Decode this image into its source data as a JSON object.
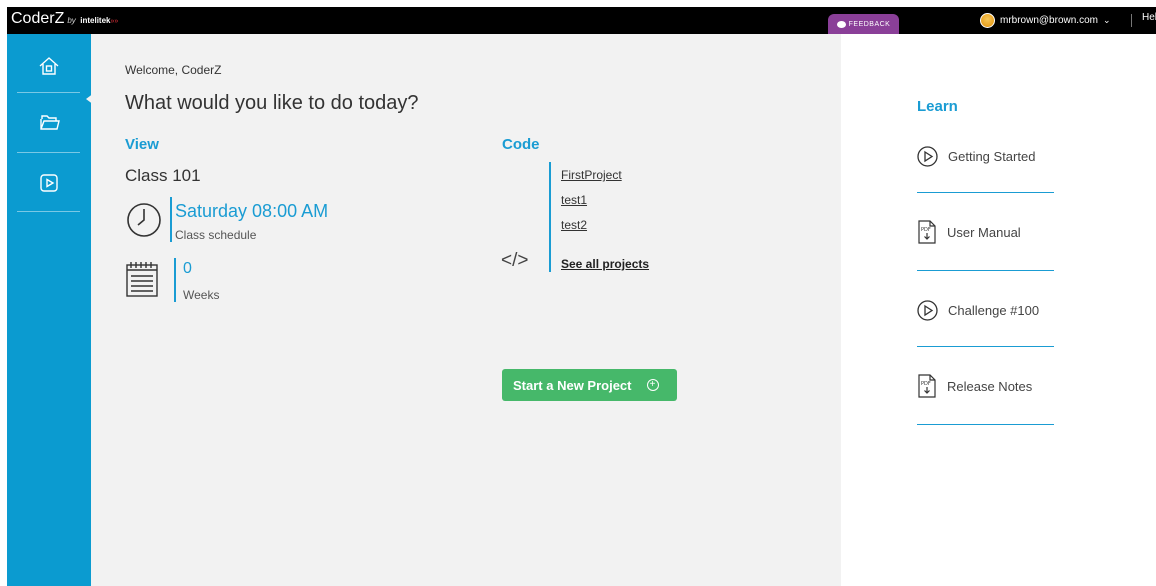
{
  "topbar": {
    "brand": "CoderZ",
    "brand_by": "by",
    "brand_company": "intelitek",
    "brand_arrows": "»»",
    "feedback_label": "FEEDBACK",
    "user_email": "mrbrown@brown.com",
    "help_label": "Help"
  },
  "sidebar": {
    "items": [
      {
        "icon": "home-icon"
      },
      {
        "icon": "folder-icon"
      },
      {
        "icon": "play-icon"
      }
    ]
  },
  "main": {
    "welcome": "Welcome, CoderZ",
    "headline": "What would you like to do today?",
    "view": {
      "heading": "View",
      "class_name": "Class 101",
      "schedule_time": "Saturday 08:00 AM",
      "schedule_label": "Class schedule",
      "weeks_value": "0",
      "weeks_label": "Weeks"
    },
    "code": {
      "heading": "Code",
      "icon_text": "</>",
      "projects": [
        "FirstProject",
        "test1",
        "test2"
      ],
      "see_all": "See all projects"
    },
    "new_project_button": "Start a New Project"
  },
  "learn": {
    "heading": "Learn",
    "items": [
      {
        "label": "Getting Started",
        "icon": "play-circle-icon"
      },
      {
        "label": "User Manual",
        "icon": "pdf-download-icon"
      },
      {
        "label": "Challenge #100",
        "icon": "play-circle-icon"
      },
      {
        "label": "Release Notes",
        "icon": "pdf-download-icon"
      }
    ]
  },
  "colors": {
    "sidebar": "#0b9bd0",
    "accent": "#1a9cd3",
    "button": "#46b86a",
    "feedback": "#8a3f98"
  }
}
